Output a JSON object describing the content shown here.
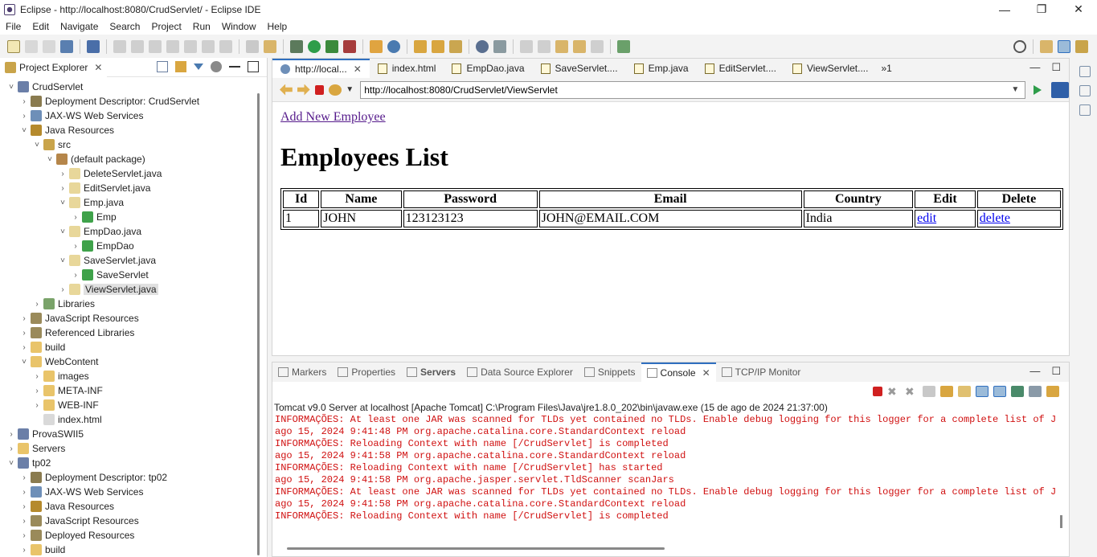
{
  "window": {
    "title": "Eclipse - http://localhost:8080/CrudServlet/ - Eclipse IDE",
    "controls": {
      "minimize": "—",
      "maximize": "❐",
      "close": "✕"
    }
  },
  "menu": [
    "File",
    "Edit",
    "Navigate",
    "Search",
    "Project",
    "Run",
    "Window",
    "Help"
  ],
  "explorer": {
    "tab_label": "Project Explorer",
    "close": "✕",
    "tree": [
      {
        "label": "CrudServlet",
        "indent": 0,
        "twisty": "˅",
        "icon": "project-icon",
        "color": "#6b7fa8"
      },
      {
        "label": "Deployment Descriptor: CrudServlet",
        "indent": 1,
        "twisty": "›",
        "icon": "descriptor-icon",
        "color": "#8a7b4f"
      },
      {
        "label": "JAX-WS Web Services",
        "indent": 1,
        "twisty": "›",
        "icon": "webservice-icon",
        "color": "#6e8fb8"
      },
      {
        "label": "Java Resources",
        "indent": 1,
        "twisty": "˅",
        "icon": "java-resources-icon",
        "color": "#b58a2d"
      },
      {
        "label": "src",
        "indent": 2,
        "twisty": "˅",
        "icon": "source-folder-icon",
        "color": "#c9a44a"
      },
      {
        "label": "(default package)",
        "indent": 3,
        "twisty": "˅",
        "icon": "package-icon",
        "color": "#b5864a"
      },
      {
        "label": "DeleteServlet.java",
        "indent": 4,
        "twisty": "›",
        "icon": "java-file-icon",
        "color": "#e8d79a"
      },
      {
        "label": "EditServlet.java",
        "indent": 4,
        "twisty": "›",
        "icon": "java-file-icon",
        "color": "#e8d79a"
      },
      {
        "label": "Emp.java",
        "indent": 4,
        "twisty": "˅",
        "icon": "java-file-icon",
        "color": "#e8d79a"
      },
      {
        "label": "Emp",
        "indent": 5,
        "twisty": "›",
        "icon": "class-icon",
        "color": "#3fa24a"
      },
      {
        "label": "EmpDao.java",
        "indent": 4,
        "twisty": "˅",
        "icon": "java-file-icon",
        "color": "#e8d79a"
      },
      {
        "label": "EmpDao",
        "indent": 5,
        "twisty": "›",
        "icon": "class-icon",
        "color": "#3fa24a"
      },
      {
        "label": "SaveServlet.java",
        "indent": 4,
        "twisty": "˅",
        "icon": "java-file-icon",
        "color": "#e8d79a"
      },
      {
        "label": "SaveServlet",
        "indent": 5,
        "twisty": "›",
        "icon": "class-icon",
        "color": "#3fa24a"
      },
      {
        "label": "ViewServlet.java",
        "indent": 4,
        "twisty": "›",
        "icon": "java-file-icon",
        "color": "#e8d79a",
        "selected": true
      },
      {
        "label": "Libraries",
        "indent": 2,
        "twisty": "›",
        "icon": "libraries-icon",
        "color": "#7aa36a"
      },
      {
        "label": "JavaScript Resources",
        "indent": 1,
        "twisty": "›",
        "icon": "js-resources-icon",
        "color": "#9a8a5a"
      },
      {
        "label": "Referenced Libraries",
        "indent": 1,
        "twisty": "›",
        "icon": "referenced-libraries-icon",
        "color": "#9a8a5a"
      },
      {
        "label": "build",
        "indent": 1,
        "twisty": "›",
        "icon": "folder-icon",
        "color": "#e9c46a"
      },
      {
        "label": "WebContent",
        "indent": 1,
        "twisty": "˅",
        "icon": "folder-icon",
        "color": "#e9c46a"
      },
      {
        "label": "images",
        "indent": 2,
        "twisty": "›",
        "icon": "folder-icon",
        "color": "#e9c46a"
      },
      {
        "label": "META-INF",
        "indent": 2,
        "twisty": "›",
        "icon": "folder-icon",
        "color": "#e9c46a"
      },
      {
        "label": "WEB-INF",
        "indent": 2,
        "twisty": "›",
        "icon": "folder-icon",
        "color": "#e9c46a"
      },
      {
        "label": "index.html",
        "indent": 2,
        "twisty": "",
        "icon": "html-file-icon",
        "color": "#d9d9d9"
      },
      {
        "label": "ProvaSWII5",
        "indent": 0,
        "twisty": "›",
        "icon": "project-icon",
        "color": "#6b7fa8"
      },
      {
        "label": "Servers",
        "indent": 0,
        "twisty": "›",
        "icon": "folder-icon",
        "color": "#e9c46a"
      },
      {
        "label": "tp02",
        "indent": 0,
        "twisty": "˅",
        "icon": "project-icon",
        "color": "#6b7fa8"
      },
      {
        "label": "Deployment Descriptor: tp02",
        "indent": 1,
        "twisty": "›",
        "icon": "descriptor-icon",
        "color": "#8a7b4f"
      },
      {
        "label": "JAX-WS Web Services",
        "indent": 1,
        "twisty": "›",
        "icon": "webservice-icon",
        "color": "#6e8fb8"
      },
      {
        "label": "Java Resources",
        "indent": 1,
        "twisty": "›",
        "icon": "java-resources-icon",
        "color": "#b58a2d"
      },
      {
        "label": "JavaScript Resources",
        "indent": 1,
        "twisty": "›",
        "icon": "js-resources-icon",
        "color": "#9a8a5a"
      },
      {
        "label": "Deployed Resources",
        "indent": 1,
        "twisty": "›",
        "icon": "deployed-resources-icon",
        "color": "#9a8a5a"
      },
      {
        "label": "build",
        "indent": 1,
        "twisty": "›",
        "icon": "folder-icon",
        "color": "#e9c46a"
      }
    ]
  },
  "editor": {
    "tabs": [
      {
        "label": "http://local...",
        "active": true,
        "icon": "globe"
      },
      {
        "label": "index.html",
        "active": false,
        "icon": "file"
      },
      {
        "label": "EmpDao.java",
        "active": false,
        "icon": "file"
      },
      {
        "label": "SaveServlet....",
        "active": false,
        "icon": "file"
      },
      {
        "label": "Emp.java",
        "active": false,
        "icon": "file"
      },
      {
        "label": "EditServlet....",
        "active": false,
        "icon": "file"
      },
      {
        "label": "ViewServlet....",
        "active": false,
        "icon": "file"
      }
    ],
    "more_tabs": "»1",
    "close": "✕",
    "url": "http://localhost:8080/CrudServlet/ViewServlet"
  },
  "webpage": {
    "link": "Add New Employee",
    "heading": "Employees List",
    "columns": [
      "Id",
      "Name",
      "Password",
      "Email",
      "Country",
      "Edit",
      "Delete"
    ],
    "rows": [
      {
        "id": "1",
        "name": "JOHN",
        "password": "123123123",
        "email": "JOHN@EMAIL.COM",
        "country": "India",
        "edit": "edit",
        "delete": "delete"
      }
    ]
  },
  "console": {
    "tabs": [
      {
        "label": "Markers",
        "active": false,
        "bold": false
      },
      {
        "label": "Properties",
        "active": false,
        "bold": false
      },
      {
        "label": "Servers",
        "active": false,
        "bold": true
      },
      {
        "label": "Data Source Explorer",
        "active": false,
        "bold": false
      },
      {
        "label": "Snippets",
        "active": false,
        "bold": false
      },
      {
        "label": "Console",
        "active": true,
        "bold": false
      },
      {
        "label": "TCP/IP Monitor",
        "active": false,
        "bold": false
      }
    ],
    "description": "Tomcat v9.0 Server at localhost [Apache Tomcat] C:\\Program Files\\Java\\jre1.8.0_202\\bin\\javaw.exe  (15 de ago de 2024 21:37:00)",
    "lines": [
      "INFORMAÇÕES: At least one JAR was scanned for TLDs yet contained no TLDs. Enable debug logging for this logger for a complete list of JARs",
      "ago 15, 2024 9:41:48 PM org.apache.catalina.core.StandardContext reload",
      "INFORMAÇÕES: Reloading Context with name [/CrudServlet] is completed",
      "ago 15, 2024 9:41:58 PM org.apache.catalina.core.StandardContext reload",
      "INFORMAÇÕES: Reloading Context with name [/CrudServlet] has started",
      "ago 15, 2024 9:41:58 PM org.apache.jasper.servlet.TldScanner scanJars",
      "INFORMAÇÕES: At least one JAR was scanned for TLDs yet contained no TLDs. Enable debug logging for this logger for a complete list of JARs",
      "ago 15, 2024 9:41:58 PM org.apache.catalina.core.StandardContext reload",
      "INFORMAÇÕES: Reloading Context with name [/CrudServlet] is completed"
    ],
    "error_color": "#d01010"
  },
  "colors": {
    "accent": "#2f6fbf",
    "link_visited": "#551a8b",
    "link": "#0000ee"
  }
}
